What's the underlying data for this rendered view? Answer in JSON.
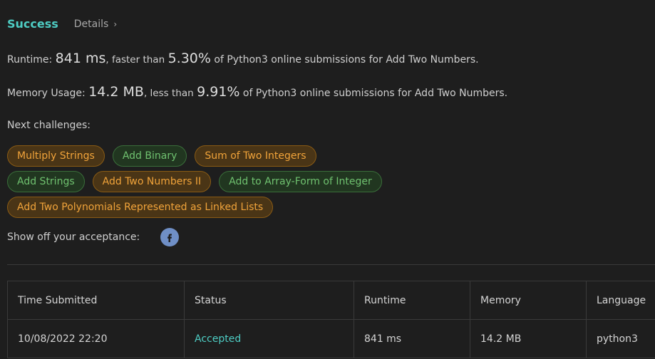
{
  "header": {
    "status": "Success",
    "details_label": "Details",
    "chevron": "›"
  },
  "runtime_line": {
    "label": "Runtime:",
    "value": "841 ms",
    "compare_word": ", faster than",
    "percent": "5.30%",
    "suffix": "of Python3 online submissions for Add Two Numbers."
  },
  "memory_line": {
    "label": "Memory Usage:",
    "value": "14.2 MB",
    "compare_word": ", less than",
    "percent": "9.91%",
    "suffix": "of Python3 online submissions for Add Two Numbers."
  },
  "next_challenges": {
    "label": "Next challenges:",
    "items": [
      {
        "label": "Multiply Strings",
        "difficulty": "medium"
      },
      {
        "label": "Add Binary",
        "difficulty": "easy"
      },
      {
        "label": "Sum of Two Integers",
        "difficulty": "medium"
      },
      {
        "label": "Add Strings",
        "difficulty": "easy"
      },
      {
        "label": "Add Two Numbers II",
        "difficulty": "medium"
      },
      {
        "label": "Add to Array-Form of Integer",
        "difficulty": "easy"
      },
      {
        "label": "Add Two Polynomials Represented as Linked Lists",
        "difficulty": "medium"
      }
    ]
  },
  "share": {
    "label": "Show off your acceptance:",
    "icon": "facebook-icon"
  },
  "table": {
    "headers": [
      "Time Submitted",
      "Status",
      "Runtime",
      "Memory",
      "Language"
    ],
    "rows": [
      [
        "10/08/2022 22:20",
        "Accepted",
        "841 ms",
        "14.2 MB",
        "python3"
      ]
    ]
  },
  "colors": {
    "success": "#4ecdc4",
    "medium_text": "#f0a33a",
    "easy_text": "#6fc16f",
    "background": "#1e1e1e"
  }
}
